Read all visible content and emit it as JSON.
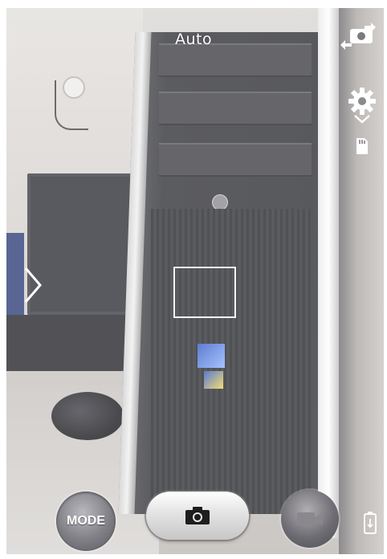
{
  "top_bar": {
    "mode_label": "Auto"
  },
  "icons": {
    "switch_camera": "switch-camera-icon",
    "settings": "gear-icon",
    "storage": "sd-card-icon",
    "next": "chevron-right-icon",
    "battery": "battery-icon",
    "camera": "camera-icon",
    "video": "video-camera-icon"
  },
  "bottom_bar": {
    "mode_button_label": "MODE"
  },
  "colors": {
    "ui_white": "#ffffff",
    "shutter_icon": "#1e1e1e"
  }
}
